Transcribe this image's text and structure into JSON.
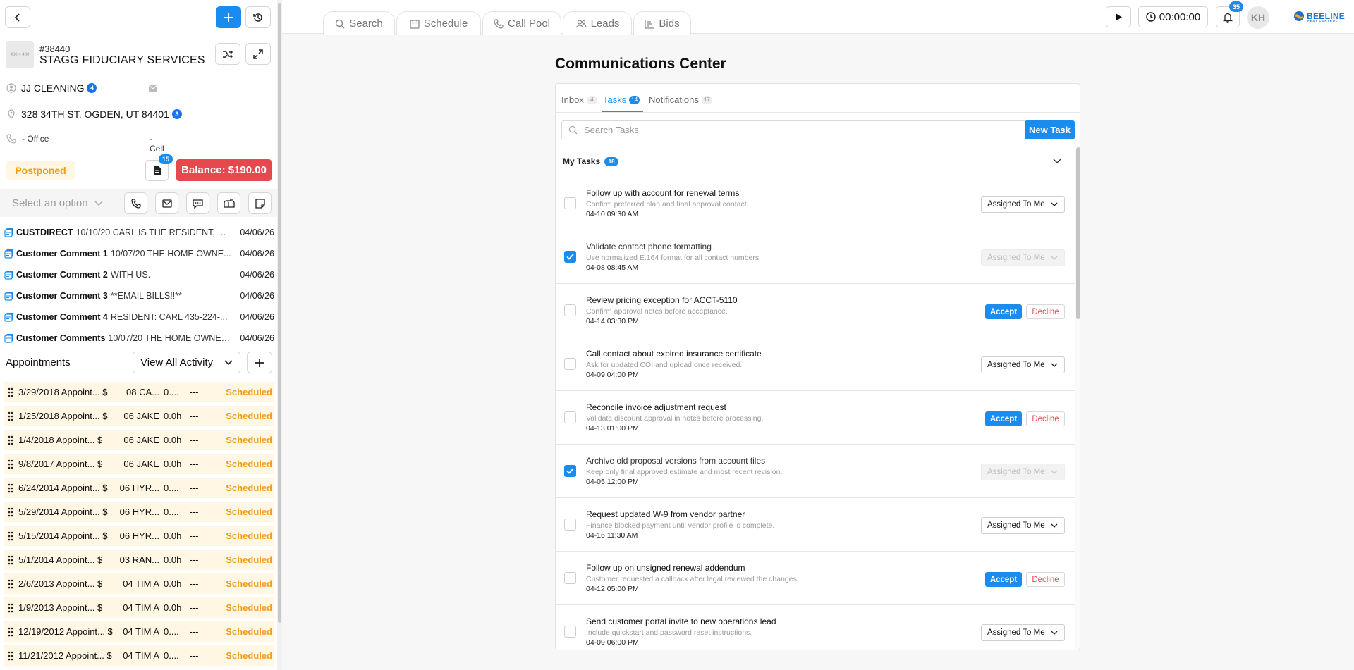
{
  "customer": {
    "logo_text": "400 × 400",
    "number": "#38440",
    "name": "STAGG FIDUCIARY SERVICES",
    "contact": "JJ CLEANING",
    "contact_count": "4",
    "address": "328 34TH ST, OGDEN, UT 84401",
    "address_count": "3",
    "phone_office": "- Office",
    "phone_cell": "- Cell",
    "status": "Postponed",
    "doc_count": "15",
    "balance": "Balance: $190.00"
  },
  "actions": {
    "select_placeholder": "Select an option"
  },
  "comments": [
    {
      "title": "CUSTDIRECT",
      "text": "10/10/20 CARL IS THE RESIDENT, HE...",
      "date": "04/06/26"
    },
    {
      "title": "Customer Comment 1",
      "text": "10/07/20 THE HOME OWNE...",
      "date": "04/06/26"
    },
    {
      "title": "Customer Comment 2",
      "text": "WITH US.",
      "date": "04/06/26"
    },
    {
      "title": "Customer Comment 3",
      "text": "**EMAIL BILLS!!**",
      "date": "04/06/26"
    },
    {
      "title": "Customer Comment 4",
      "text": "RESIDENT: CARL 435-224-...",
      "date": "04/06/26"
    },
    {
      "title": "Customer Comments",
      "text": "10/07/20 THE HOME OWNER...",
      "date": "04/06/26"
    }
  ],
  "appointments": {
    "title": "Appointments",
    "view_all": "View All Activity",
    "rows": [
      {
        "date": "3/29/2018 Appoint... $",
        "tech": "08 CA...",
        "hours": "0....",
        "dash": "---",
        "status": "Scheduled"
      },
      {
        "date": "1/25/2018 Appoint... $",
        "tech": "06 JAKE",
        "hours": "0.0h",
        "dash": "---",
        "status": "Scheduled"
      },
      {
        "date": "1/4/2018 Appoint... $",
        "tech": "06 JAKE",
        "hours": "0.0h",
        "dash": "---",
        "status": "Scheduled"
      },
      {
        "date": "9/8/2017 Appoint... $",
        "tech": "06 JAKE",
        "hours": "0.0h",
        "dash": "---",
        "status": "Scheduled"
      },
      {
        "date": "6/24/2014 Appoint... $",
        "tech": "06 HYR...",
        "hours": "0....",
        "dash": "---",
        "status": "Scheduled"
      },
      {
        "date": "5/29/2014 Appoint... $",
        "tech": "06 HYR...",
        "hours": "0....",
        "dash": "---",
        "status": "Scheduled"
      },
      {
        "date": "5/15/2014 Appoint... $",
        "tech": "06 HYR...",
        "hours": "0.0h",
        "dash": "---",
        "status": "Scheduled"
      },
      {
        "date": "5/1/2014 Appoint... $",
        "tech": "03 RAN...",
        "hours": "0.0h",
        "dash": "---",
        "status": "Scheduled"
      },
      {
        "date": "2/6/2013 Appoint... $",
        "tech": "04 TIM A",
        "hours": "0.0h",
        "dash": "---",
        "status": "Scheduled"
      },
      {
        "date": "1/9/2013 Appoint... $",
        "tech": "04 TIM A",
        "hours": "0.0h",
        "dash": "---",
        "status": "Scheduled"
      },
      {
        "date": "12/19/2012 Appoint... $",
        "tech": "04 TIM A",
        "hours": "0....",
        "dash": "---",
        "status": "Scheduled"
      },
      {
        "date": "11/21/2012 Appoint... $",
        "tech": "04 TIM A",
        "hours": "0....",
        "dash": "---",
        "status": "Scheduled"
      }
    ]
  },
  "nav": {
    "tabs": [
      "Search",
      "Schedule",
      "Call Pool",
      "Leads",
      "Bids"
    ],
    "timer": "00:00:00",
    "notification_count": "35",
    "avatar_initials": "KH",
    "brand": "BEELINE",
    "brand_sub": "PEST CONTROL"
  },
  "comms": {
    "title": "Communications Center",
    "tabs": [
      {
        "label": "Inbox",
        "count": "4"
      },
      {
        "label": "Tasks",
        "count": "14"
      },
      {
        "label": "Notifications",
        "count": "17"
      }
    ],
    "search_placeholder": "Search Tasks",
    "new_task": "New Task",
    "my_tasks_label": "My Tasks",
    "my_tasks_count": "18",
    "assigned_label": "Assigned To Me",
    "accept_label": "Accept",
    "decline_label": "Decline",
    "tasks": [
      {
        "title": "Follow up with account for renewal terms",
        "desc": "Confirm preferred plan and final approval contact.",
        "time": "04-10 09:30 AM"
      },
      {
        "title": "Validate contact phone formatting",
        "desc": "Use normalized E.164 format for all contact numbers.",
        "time": "04-08 08:45 AM"
      },
      {
        "title": "Review pricing exception for ACCT-5110",
        "desc": "Confirm approval notes before acceptance.",
        "time": "04-14 03:30 PM"
      },
      {
        "title": "Call contact about expired insurance certificate",
        "desc": "Ask for updated COI and upload once received.",
        "time": "04-09 04:00 PM"
      },
      {
        "title": "Reconcile invoice adjustment request",
        "desc": "Validate discount approval in notes before processing.",
        "time": "04-13 01:00 PM"
      },
      {
        "title": "Archive old proposal versions from account files",
        "desc": "Keep only final approved estimate and most recent revision.",
        "time": "04-05 12:00 PM"
      },
      {
        "title": "Request updated W-9 from vendor partner",
        "desc": "Finance blocked payment until vendor profile is complete.",
        "time": "04-16 11:30 AM"
      },
      {
        "title": "Follow up on unsigned renewal addendum",
        "desc": "Customer requested a callback after legal reviewed the changes.",
        "time": "04-12 05:00 PM"
      },
      {
        "title": "Send customer portal invite to new operations lead",
        "desc": "Include quickstart and password reset instructions.",
        "time": "04-09 06:00 PM"
      }
    ]
  }
}
